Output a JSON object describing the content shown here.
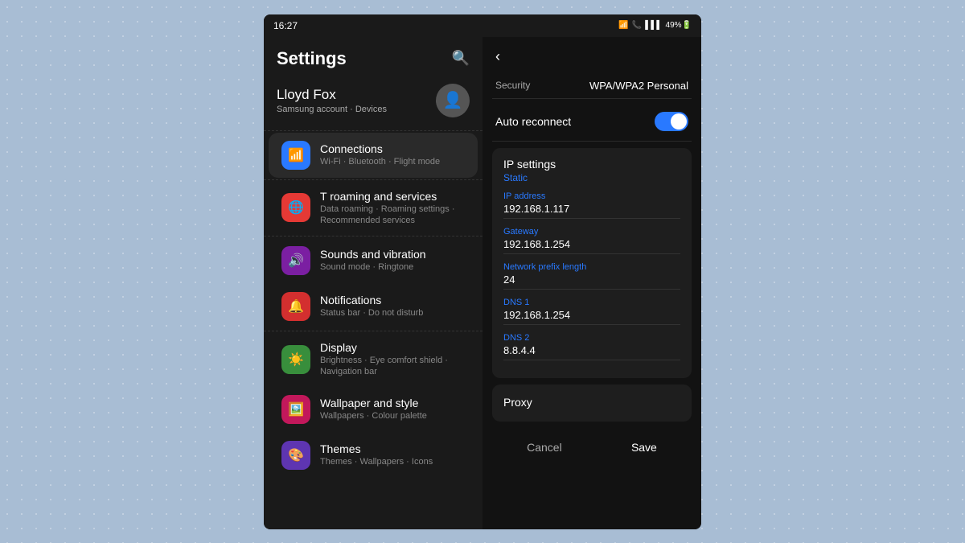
{
  "statusBar": {
    "time": "16:27",
    "icons": "🔔 📷 📶 🔋 49%"
  },
  "settingsPanel": {
    "title": "Settings",
    "user": {
      "name": "Lloyd Fox",
      "sub": "Samsung account · Devices"
    },
    "menuItems": [
      {
        "id": "connections",
        "title": "Connections",
        "sub": "Wi-Fi · Bluetooth · Flight mode",
        "iconColor": "blue",
        "icon": "📶",
        "active": true
      },
      {
        "id": "t-roaming",
        "title": "T roaming and services",
        "sub": "Data roaming · Roaming settings · Recommended services",
        "iconColor": "red-orange",
        "icon": "🌐",
        "active": false
      },
      {
        "id": "sounds",
        "title": "Sounds and vibration",
        "sub": "Sound mode · Ringtone",
        "iconColor": "purple",
        "icon": "🔊",
        "active": false
      },
      {
        "id": "notifications",
        "title": "Notifications",
        "sub": "Status bar · Do not disturb",
        "iconColor": "red",
        "icon": "🔔",
        "active": false
      },
      {
        "id": "display",
        "title": "Display",
        "sub": "Brightness · Eye comfort shield · Navigation bar",
        "iconColor": "green",
        "icon": "☀️",
        "active": false
      },
      {
        "id": "wallpaper",
        "title": "Wallpaper and style",
        "sub": "Wallpapers · Colour palette",
        "iconColor": "pink",
        "icon": "🖼️",
        "active": false
      },
      {
        "id": "themes",
        "title": "Themes",
        "sub": "Themes · Wallpapers · Icons",
        "iconColor": "violet",
        "icon": "🎨",
        "active": false
      }
    ]
  },
  "wifiPanel": {
    "securityLabel": "Security",
    "securityValue": "WPA/WPA2 Personal",
    "autoReconnectLabel": "Auto reconnect",
    "autoReconnectEnabled": true,
    "ipSettings": {
      "title": "IP settings",
      "subtitle": "Static",
      "fields": [
        {
          "label": "IP address",
          "value": "192.168.1.117"
        },
        {
          "label": "Gateway",
          "value": "192.168.1.254"
        },
        {
          "label": "Network prefix length",
          "value": "24"
        },
        {
          "label": "DNS 1",
          "value": "192.168.1.254"
        },
        {
          "label": "DNS 2",
          "value": "8.8.4.4"
        }
      ]
    },
    "proxyLabel": "Proxy",
    "cancelLabel": "Cancel",
    "saveLabel": "Save"
  }
}
